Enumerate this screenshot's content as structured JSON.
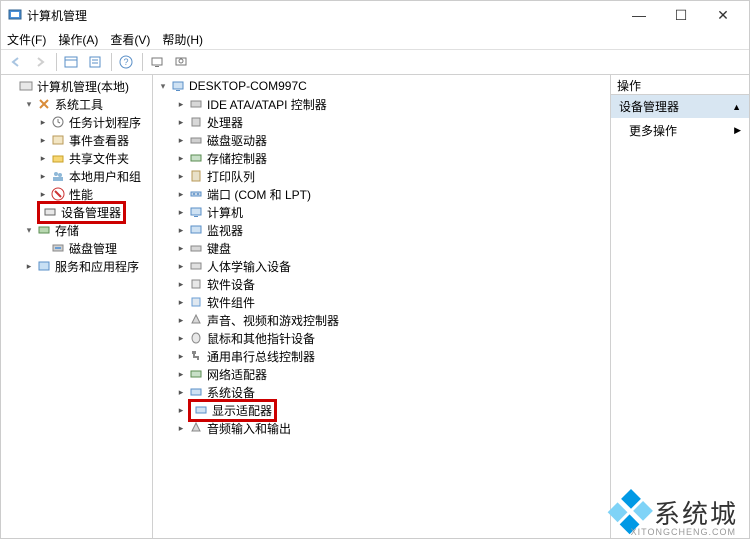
{
  "window": {
    "title": "计算机管理",
    "min": "—",
    "max": "☐",
    "close": "✕"
  },
  "menu": {
    "file": "文件(F)",
    "action": "操作(A)",
    "view": "查看(V)",
    "help": "帮助(H)"
  },
  "left_tree": {
    "root": "计算机管理(本地)",
    "system_tools": "系统工具",
    "task_scheduler": "任务计划程序",
    "event_viewer": "事件查看器",
    "shared_folders": "共享文件夹",
    "local_users": "本地用户和组",
    "performance": "性能",
    "device_manager": "设备管理器",
    "storage": "存储",
    "disk_mgmt": "磁盘管理",
    "services_apps": "服务和应用程序"
  },
  "mid_tree": {
    "root": "DESKTOP-COM997C",
    "items": [
      "IDE ATA/ATAPI 控制器",
      "处理器",
      "磁盘驱动器",
      "存储控制器",
      "打印队列",
      "端口 (COM 和 LPT)",
      "计算机",
      "监视器",
      "键盘",
      "人体学输入设备",
      "软件设备",
      "软件组件",
      "声音、视频和游戏控制器",
      "鼠标和其他指针设备",
      "通用串行总线控制器",
      "网络适配器",
      "系统设备",
      "显示适配器",
      "音频输入和输出"
    ]
  },
  "right": {
    "header": "操作",
    "title": "设备管理器",
    "more": "更多操作"
  },
  "watermark": {
    "name": "系统城",
    "url": "XITONGCHENG.COM"
  }
}
